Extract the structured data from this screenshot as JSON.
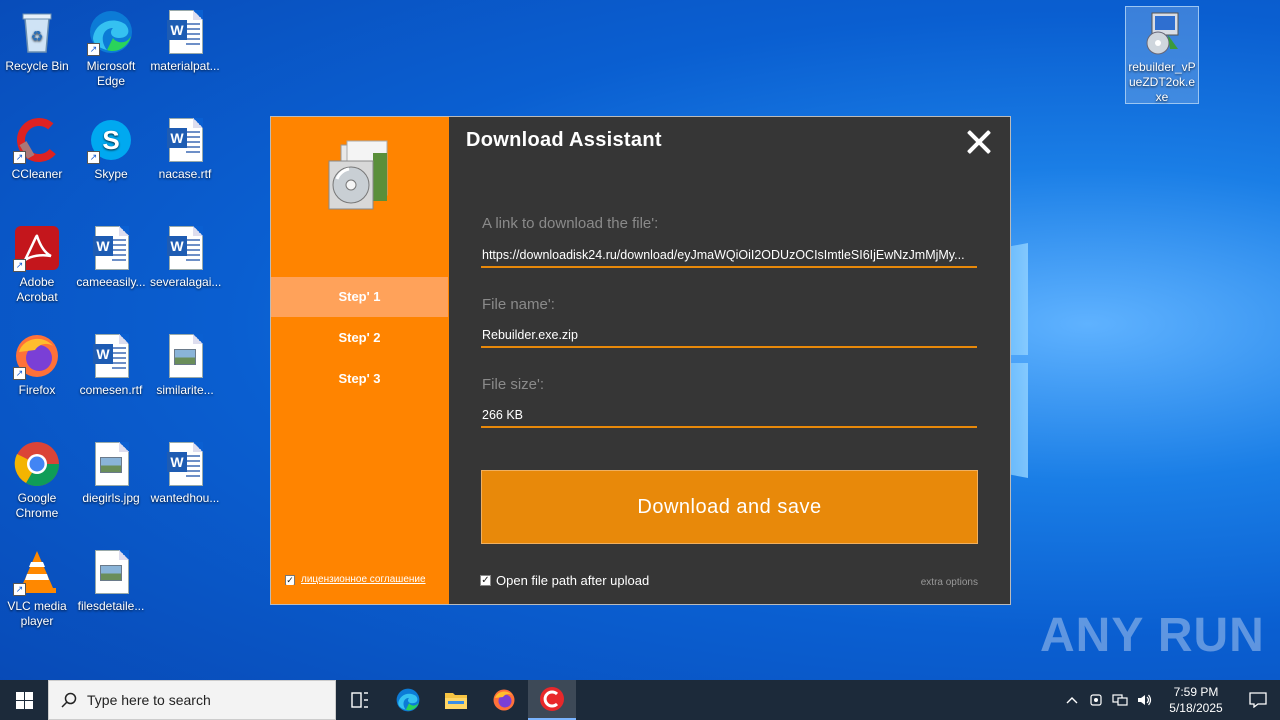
{
  "desktop": {
    "icons": [
      {
        "label": "Recycle Bin"
      },
      {
        "label": "Microsoft Edge"
      },
      {
        "label": "materialpat..."
      },
      {
        "label": "CCleaner"
      },
      {
        "label": "Skype"
      },
      {
        "label": "nacase.rtf"
      },
      {
        "label": "Adobe Acrobat"
      },
      {
        "label": "cameeasily..."
      },
      {
        "label": "severalagai..."
      },
      {
        "label": "Firefox"
      },
      {
        "label": "comesen.rtf"
      },
      {
        "label": "similarite..."
      },
      {
        "label": "Google Chrome"
      },
      {
        "label": "diegirls.jpg"
      },
      {
        "label": "wantedhou..."
      },
      {
        "label": "VLC media player"
      },
      {
        "label": "filesdetaile..."
      },
      {
        "label": "rebuilder_vPueZDT2ok.exe"
      }
    ]
  },
  "dialog": {
    "title": "Download Assistant",
    "steps": [
      "Step' 1",
      "Step' 2",
      "Step' 3"
    ],
    "active_step": 0,
    "license_link": "лицензионное соглашение",
    "link_label": "A link to download the file':",
    "link_value": "https://downloadisk24.ru/download/eyJmaWQiOiI2ODUzOCIsImtleSI6IjEwNzJmMjMy...",
    "filename_label": "File name':",
    "filename_value": "Rebuilder.exe.zip",
    "filesize_label": "File size':",
    "filesize_value": "266 KB",
    "download_button": "Download and save",
    "open_path_label": "Open file path after upload",
    "open_path_checked": true,
    "extra_options": "extra options",
    "accent_color": "#ff8400",
    "button_color": "#e8890a"
  },
  "watermark": "ANY RUN",
  "taskbar": {
    "search_placeholder": "Type here to search",
    "time": "7:59 PM",
    "date": "5/18/2025"
  }
}
